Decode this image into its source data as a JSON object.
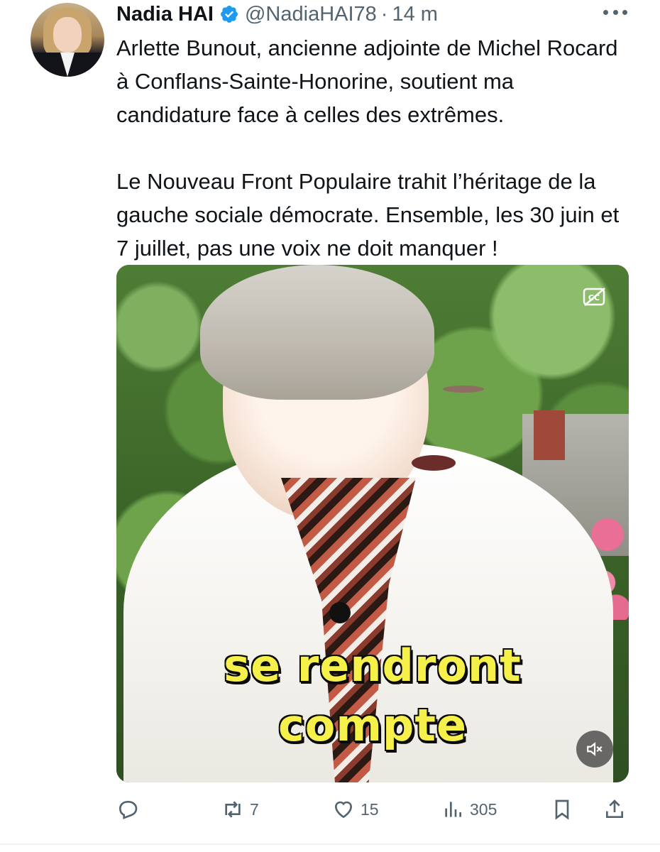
{
  "author": {
    "name": "Nadia HAI",
    "handle": "@NadiaHAI78",
    "separator": "·",
    "time": "14 m",
    "verified": true
  },
  "tweet": {
    "paragraph1": "Arlette Bunout, ancienne adjointe de Michel Rocard à Conflans-Sainte-Honorine, soutient ma candidature face à celles des extrêmes.",
    "paragraph2": "Le Nouveau Front Populaire trahit l’héritage de la gauche sociale démocrate. Ensemble, les 30 juin et 7 juillet, pas une voix ne doit manquer !"
  },
  "video": {
    "caption_line1": "se rendront",
    "caption_line2": "compte",
    "caption_color": "#f6f04a",
    "controls": [
      "captions-off-icon",
      "muted-speaker-icon"
    ]
  },
  "actions": {
    "reply": {
      "icon": "reply-icon",
      "count": ""
    },
    "retweet": {
      "icon": "retweet-icon",
      "count": "7"
    },
    "like": {
      "icon": "heart-icon",
      "count": "15"
    },
    "views": {
      "icon": "views-icon",
      "count": "305"
    },
    "bookmark": {
      "icon": "bookmark-icon",
      "count": ""
    },
    "share": {
      "icon": "share-icon",
      "count": ""
    }
  },
  "colors": {
    "verified_blue": "#1d9bf0",
    "text_primary": "#0f1419",
    "text_secondary": "#536471"
  }
}
